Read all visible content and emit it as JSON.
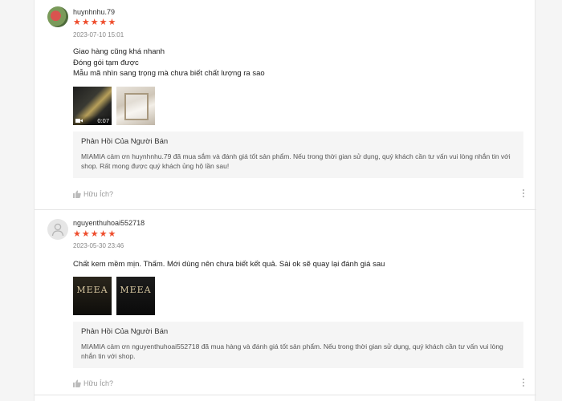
{
  "reviews": [
    {
      "username": "huynhnhu.79",
      "rating": 5,
      "stars": [
        "★",
        "★",
        "★",
        "★",
        "★"
      ],
      "timestamp": "2023-07-10 15:01",
      "lines": [
        "Giao hàng cũng khá nhanh",
        "Đóng gói tạm được",
        "Mẫu mã nhìn sang trọng mà chưa biết chất lượng ra sao"
      ],
      "media": [
        {
          "type": "video",
          "duration": "0:07",
          "icon": "video-camera-icon"
        },
        {
          "type": "image"
        }
      ],
      "reply": {
        "title": "Phản Hồi Của Người Bán",
        "text": "MIAMIA cảm ơn huynhnhu.79 đã mua sắm và đánh giá tốt sản phẩm. Nếu trong thời gian sử dụng, quý khách cần tư vấn vui lòng nhắn tin với shop. Rất mong được quý khách ủng hộ lần sau!"
      },
      "helpful_label": "Hữu Ích?"
    },
    {
      "username": "nguyenthuhoai552718",
      "rating": 5,
      "stars": [
        "★",
        "★",
        "★",
        "★",
        "★"
      ],
      "timestamp": "2023-05-30 23:46",
      "lines": [
        "Chất kem mềm mịn. Thấm. Mới dùng nên chưa biết kết quả. Sài ok sẽ quay lại đánh giá sau"
      ],
      "media": [
        {
          "type": "image",
          "brand": "MEEA"
        },
        {
          "type": "image",
          "brand": "MEEA"
        }
      ],
      "reply": {
        "title": "Phản Hồi Của Người Bán",
        "text": "MIAMIA cảm ơn nguyenthuhoai552718 đã mua hàng và đánh giá tốt sản phẩm. Nếu trong thời gian sử dụng, quý khách cần tư vấn vui lòng nhắn tin với shop."
      },
      "helpful_label": "Hữu Ích?"
    }
  ],
  "colors": {
    "star": "#ee4d2d",
    "reply_bg": "#f5f5f5",
    "muted": "#999999"
  }
}
